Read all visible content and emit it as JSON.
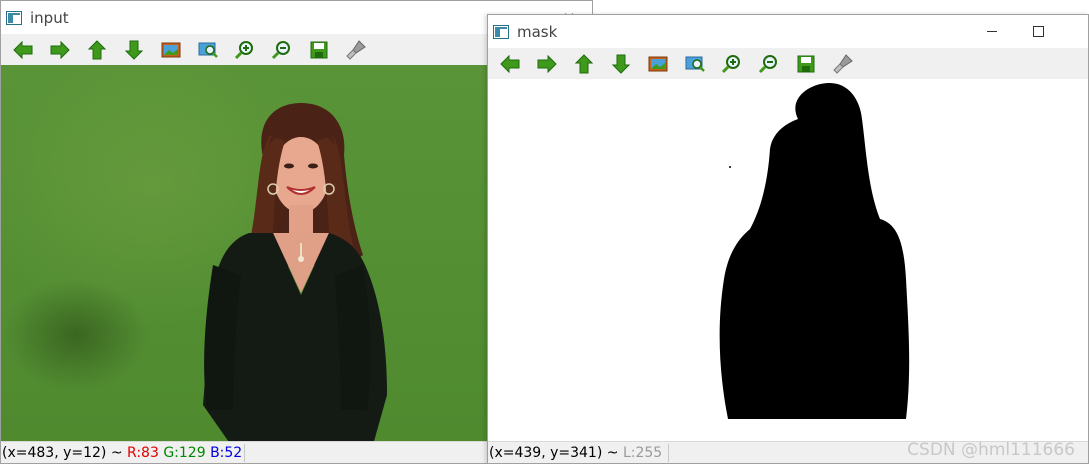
{
  "input_window": {
    "title": "input",
    "close_glyph": "✕",
    "status": {
      "coords": "(x=483, y=12) ~",
      "r": "R:83",
      "g": "G:129",
      "b": "B:52"
    }
  },
  "mask_window": {
    "title": "mask",
    "status": {
      "coords": "(x=439, y=341) ~",
      "l": "L:255"
    }
  },
  "toolbar_items": [
    "arrow-left-icon",
    "arrow-right-icon",
    "arrow-up-icon",
    "arrow-down-icon",
    "image-icon",
    "zoom-fit-icon",
    "zoom-in-icon",
    "zoom-out-icon",
    "save-icon",
    "properties-icon"
  ],
  "watermark": "CSDN @hml111666",
  "colors": {
    "green_screen": "#5a9438",
    "toolbar_bg": "#f0f0f0",
    "icon_green": "#3f9a1c"
  }
}
